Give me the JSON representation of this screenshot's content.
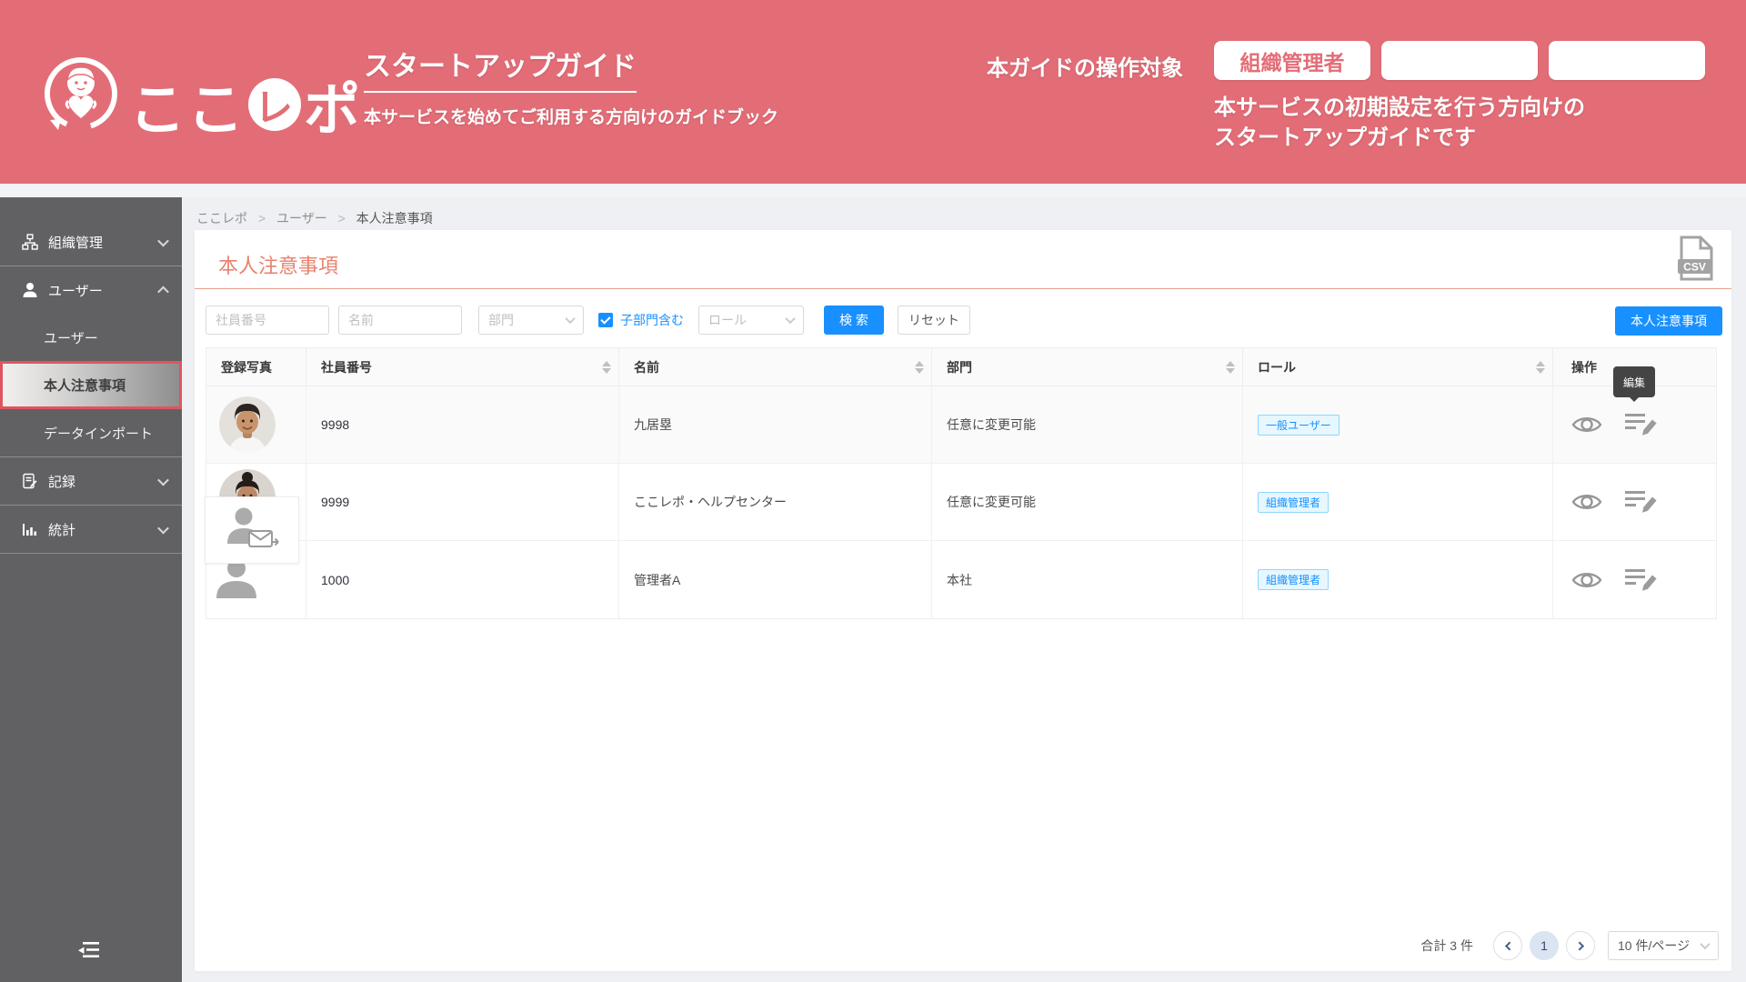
{
  "colors": {
    "brand": "#e36d77",
    "sidebar": "#616163",
    "blue": "#1890ff",
    "coral": "#e8826f",
    "coral_line": "#e9a08c",
    "content_bg": "#eef0f3",
    "active_border": "#e0545f",
    "tag_bg": "#e6f7ff",
    "tag_border": "#91d5ff"
  },
  "header": {
    "logo_prefix": "ここ",
    "logo_circle": "レ",
    "logo_suffix": "ポ",
    "title": "スタートアップガイド",
    "subtitle": "本サービスを始めてご利用する方向けのガイドブック",
    "target_label": "本ガイドの操作対象",
    "target_role_button": "組織管理者",
    "description_line1": "本サービスの初期設定を行う方向けの",
    "description_line2": "スタートアップガイドです"
  },
  "sidebar": {
    "items": [
      {
        "label": "組織管理",
        "icon": "org-chart-icon"
      },
      {
        "label": "ユーザー",
        "icon": "user-icon",
        "expanded": true,
        "children": [
          {
            "label": "ユーザー",
            "active": false
          },
          {
            "label": "本人注意事項",
            "active": true
          },
          {
            "label": "データインポート",
            "active": false
          }
        ]
      },
      {
        "label": "記録",
        "icon": "record-icon"
      },
      {
        "label": "統計",
        "icon": "stats-icon"
      }
    ]
  },
  "breadcrumb": {
    "items": [
      "ここレポ",
      "ユーザー",
      "本人注意事項"
    ],
    "separator": ">"
  },
  "page": {
    "title": "本人注意事項",
    "csv_label": "CSV"
  },
  "filters": {
    "employee_no_placeholder": "社員番号",
    "name_placeholder": "名前",
    "department_placeholder": "部門",
    "include_sub_label": "子部門含む",
    "include_sub_checked": true,
    "role_placeholder": "ロール",
    "search_label": "検 索",
    "reset_label": "リセット",
    "add_button_label": "本人注意事項"
  },
  "table": {
    "columns": [
      "登録写真",
      "社員番号",
      "名前",
      "部門",
      "ロール",
      "操作"
    ],
    "rows": [
      {
        "employee_no": "9998",
        "name": "九居塁",
        "department": "任意に変更可能",
        "role": "一般ユーザー"
      },
      {
        "employee_no": "9999",
        "name": "ここレポ・ヘルプセンター",
        "department": "任意に変更可能",
        "role": "組織管理者"
      },
      {
        "employee_no": "1000",
        "name": "管理者A",
        "department": "本社",
        "role": "組織管理者"
      }
    ],
    "edit_tooltip": "編集"
  },
  "pagination": {
    "total_label": "合計 3 件",
    "current_page": "1",
    "page_size_label": "10 件/ページ"
  }
}
